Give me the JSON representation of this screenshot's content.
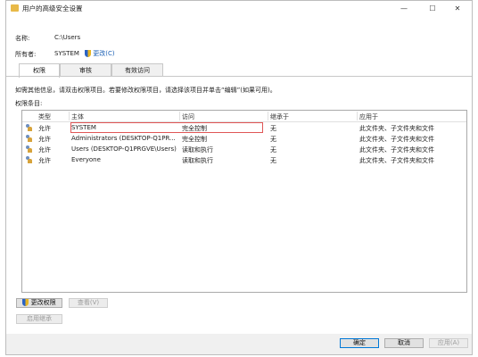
{
  "window": {
    "title": "用户的高级安全设置",
    "controls": {
      "minimize": "—",
      "maximize": "☐",
      "close": "✕"
    }
  },
  "name_row": {
    "label": "名称:",
    "value": "C:\\Users"
  },
  "owner_row": {
    "label": "所有者:",
    "value": "SYSTEM",
    "change_link": "更改(C)"
  },
  "tabs": [
    "权限",
    "审核",
    "有效访问"
  ],
  "info_text": "如需其他信息，请双击权限项目。若要修改权限项目，请选择该项目并单击“编辑”(如果可用)。",
  "entries_label": "权限条目:",
  "table": {
    "columns": [
      "类型",
      "主体",
      "访问",
      "继承于",
      "应用于"
    ],
    "rows": [
      [
        "允许",
        "SYSTEM",
        "完全控制",
        "无",
        "此文件夹、子文件夹和文件"
      ],
      [
        "允许",
        "Administrators (DESKTOP-Q1PR...",
        "完全控制",
        "无",
        "此文件夹、子文件夹和文件"
      ],
      [
        "允许",
        "Users (DESKTOP-Q1PRGVE\\Users)",
        "读取和执行",
        "无",
        "此文件夹、子文件夹和文件"
      ],
      [
        "允许",
        "Everyone",
        "读取和执行",
        "无",
        "此文件夹、子文件夹和文件"
      ]
    ],
    "selected_row": 0
  },
  "buttons": {
    "change_perm": "更改权限",
    "view": "查看(V)",
    "enable_inherit": "启用继承",
    "ok": "确定",
    "cancel": "取消",
    "apply": "应用(A)"
  },
  "colors": {
    "accent": "#0078d7",
    "link": "#1a5fb4",
    "selection_border": "#e05656"
  }
}
